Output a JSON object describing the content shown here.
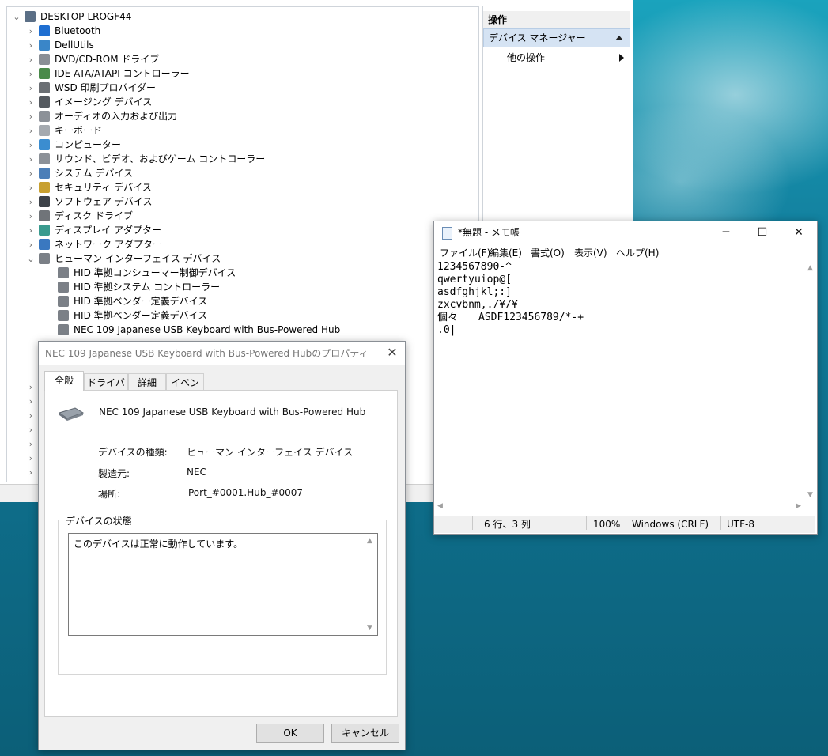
{
  "device_manager": {
    "root": "DESKTOP-LROGF44",
    "categories": [
      {
        "label": "Bluetooth",
        "icon": "bluetooth-icon"
      },
      {
        "label": "DellUtils",
        "icon": "monitor-icon"
      },
      {
        "label": "DVD/CD-ROM ドライブ",
        "icon": "dvd-icon"
      },
      {
        "label": "IDE ATA/ATAPI コントローラー",
        "icon": "ide-icon"
      },
      {
        "label": "WSD 印刷プロバイダー",
        "icon": "printer-icon"
      },
      {
        "label": "イメージング デバイス",
        "icon": "camera-icon"
      },
      {
        "label": "オーディオの入力および出力",
        "icon": "speaker-icon"
      },
      {
        "label": "キーボード",
        "icon": "keyboard-icon"
      },
      {
        "label": "コンピューター",
        "icon": "computer-icon"
      },
      {
        "label": "サウンド、ビデオ、およびゲーム コントローラー",
        "icon": "speaker-icon"
      },
      {
        "label": "システム デバイス",
        "icon": "system-icon"
      },
      {
        "label": "セキュリティ デバイス",
        "icon": "key-icon"
      },
      {
        "label": "ソフトウェア デバイス",
        "icon": "software-icon"
      },
      {
        "label": "ディスク ドライブ",
        "icon": "disk-icon"
      },
      {
        "label": "ディスプレイ アダプター",
        "icon": "display-icon"
      },
      {
        "label": "ネットワーク アダプター",
        "icon": "network-icon"
      },
      {
        "label": "ヒューマン インターフェイス デバイス",
        "icon": "hid-icon"
      }
    ],
    "hid_children": [
      "HID 準拠コンシューマー制御デバイス",
      "HID 準拠システム コントローラー",
      "HID 準拠ベンダー定義デバイス",
      "HID 準拠ベンダー定義デバイス",
      "NEC 109 Japanese USB Keyboard with Bus-Powered Hub"
    ],
    "action_pane": {
      "header": "操作",
      "selected": "デバイス マネージャー",
      "sub": "他の操作"
    }
  },
  "properties_dialog": {
    "title": "NEC 109 Japanese USB Keyboard with Bus-Powered Hubのプロパティ",
    "tabs": [
      "全般",
      "ドライバー",
      "詳細",
      "イベント"
    ],
    "device_name": "NEC 109 Japanese USB Keyboard with Bus-Powered Hub",
    "fields": [
      {
        "label": "デバイスの種類:",
        "value": "ヒューマン インターフェイス デバイス"
      },
      {
        "label": "製造元:",
        "value": "NEC"
      },
      {
        "label": "場所:",
        "value": "Port_#0001.Hub_#0007"
      }
    ],
    "status_group": "デバイスの状態",
    "status_text": "このデバイスは正常に動作しています。",
    "ok": "OK",
    "cancel": "キャンセル"
  },
  "notepad": {
    "title": "*無題 - メモ帳",
    "menu": [
      "ファイル(F)",
      "編集(E)",
      "書式(O)",
      "表示(V)",
      "ヘルプ(H)"
    ],
    "lines": [
      "1234567890-^",
      "qwertyuiop@[",
      "asdfghjkl;:]",
      "zxcvbnm,./¥/¥",
      "個々　　ASDF123456789/*-+",
      ".0|"
    ],
    "status": {
      "position": "6 行、3 列",
      "zoom": "100%",
      "eol": "Windows (CRLF)",
      "encoding": "UTF-8"
    }
  }
}
